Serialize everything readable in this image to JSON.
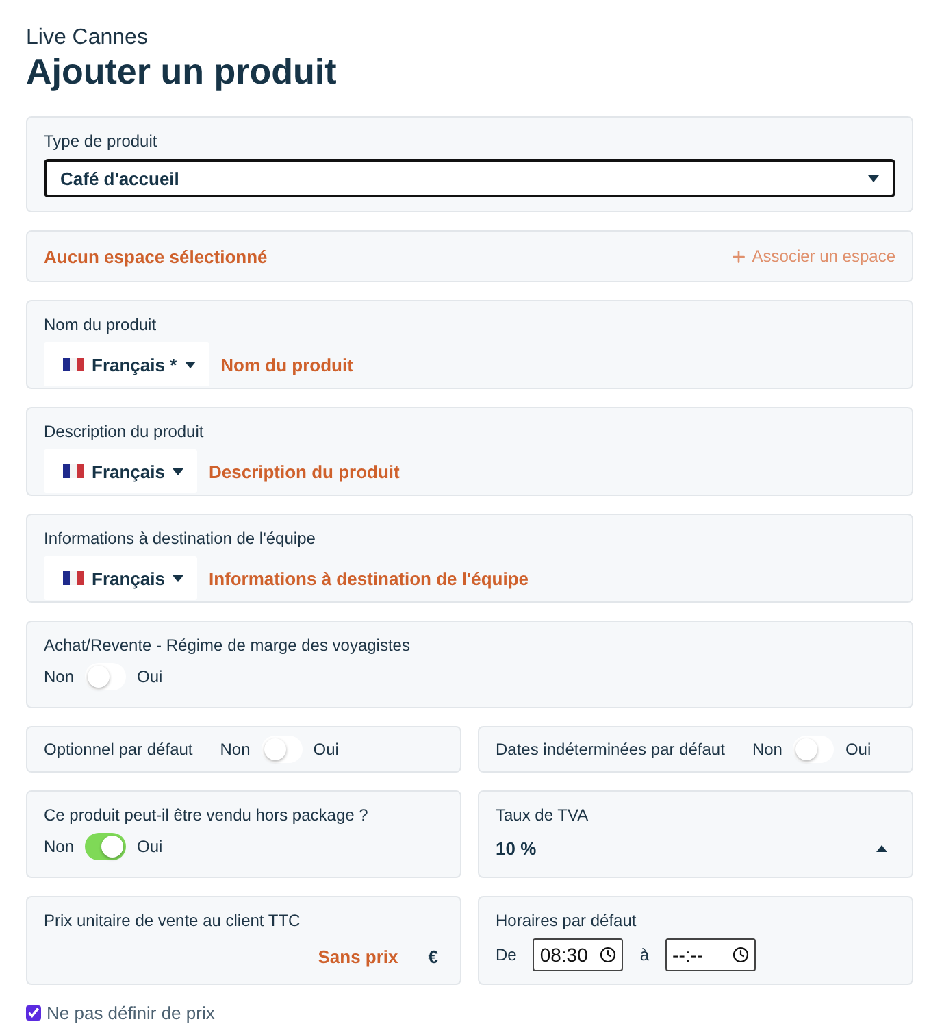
{
  "header": {
    "subtitle": "Live Cannes",
    "title": "Ajouter un produit"
  },
  "product_type": {
    "label": "Type de produit",
    "value": "Café d'accueil"
  },
  "space": {
    "status": "Aucun espace sélectionné",
    "action": "Associer un espace"
  },
  "text_fields": [
    {
      "label": "Nom du produit",
      "language": "Français *",
      "placeholder": "Nom du produit"
    },
    {
      "label": "Description du produit",
      "language": "Français",
      "placeholder": "Description du produit"
    },
    {
      "label": "Informations à destination de l'équipe",
      "language": "Français",
      "placeholder": "Informations à destination de l'équipe"
    }
  ],
  "margin_toggle": {
    "label": "Achat/Revente - Régime de marge des voyagistes",
    "off_label": "Non",
    "on_label": "Oui",
    "on": false
  },
  "default_toggles": [
    {
      "label": "Optionnel par défaut",
      "off_label": "Non",
      "on_label": "Oui",
      "on": false
    },
    {
      "label": "Dates indéterminées par défaut",
      "off_label": "Non",
      "on_label": "Oui",
      "on": false
    }
  ],
  "package_toggle": {
    "label": "Ce produit peut-il être vendu hors package ?",
    "off_label": "Non",
    "on_label": "Oui",
    "on": true
  },
  "vat": {
    "label": "Taux de TVA",
    "value": "10 %"
  },
  "price": {
    "label": "Prix unitaire de vente au client TTC",
    "value": "Sans prix",
    "currency": "€"
  },
  "hours": {
    "label": "Horaires par défaut",
    "from_label": "De",
    "start": "08:30",
    "to_label": "à",
    "end": "--:--"
  },
  "no_price": {
    "label": "Ne pas définir de prix",
    "checked": true
  }
}
